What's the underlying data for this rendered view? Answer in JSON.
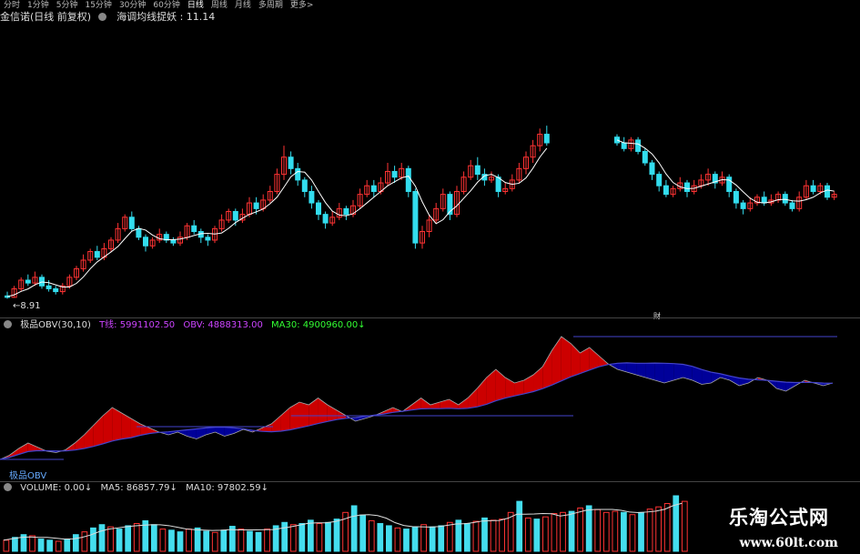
{
  "toolbar": {
    "periods": [
      "分时",
      "1分钟",
      "5分钟",
      "15分钟",
      "30分钟",
      "60分钟",
      "日线",
      "周线",
      "月线",
      "多周期",
      "更多>"
    ],
    "active_index": 6
  },
  "header": {
    "stock_name": "金信诺(日线 前复权)",
    "indicator_name": "海调均线捉妖",
    "indicator_value": ": 11.14"
  },
  "price_panel": {
    "low_label": "8.91",
    "marker_label": "财",
    "colors": {
      "up": "#ff3333",
      "down": "#33ddee",
      "ma": "#ffffff"
    }
  },
  "obv_panel": {
    "name": "极品OBV(30,10)",
    "t_label": "T线: 5991102.50",
    "obv_label": "OBV: 4888313.00",
    "ma30_label": "MA30: 4900960.00↓",
    "colors": {
      "t": "#cc44ff",
      "obv": "#cc44ff",
      "ma30": "#33ff33",
      "area_up": "#cc0000",
      "area_down": "#000099",
      "ref_line": "#4444cc"
    },
    "bottom_label": "极品OBV"
  },
  "volume_panel": {
    "name": "VOLUME: 0.00↓",
    "ma5": "MA5: 86857.79↓",
    "ma10": "MA10: 97802.59↓"
  },
  "watermark": {
    "title": "乐淘公式网",
    "url": "www.60lt.com"
  },
  "chart_data": {
    "type": "candlestick",
    "candles": [
      [
        8.95,
        8.9,
        9.1,
        8.85
      ],
      [
        8.9,
        9.2,
        9.3,
        8.88
      ],
      [
        9.2,
        9.5,
        9.6,
        9.1
      ],
      [
        9.5,
        9.4,
        9.7,
        9.3
      ],
      [
        9.4,
        9.6,
        9.8,
        9.3
      ],
      [
        9.6,
        9.3,
        9.7,
        9.2
      ],
      [
        9.3,
        9.2,
        9.5,
        9.1
      ],
      [
        9.2,
        9.1,
        9.3,
        9.0
      ],
      [
        9.1,
        9.3,
        9.4,
        9.0
      ],
      [
        9.3,
        9.6,
        9.7,
        9.2
      ],
      [
        9.6,
        9.9,
        10.0,
        9.5
      ],
      [
        9.9,
        10.2,
        10.4,
        9.8
      ],
      [
        10.2,
        10.5,
        10.6,
        10.1
      ],
      [
        10.5,
        10.3,
        10.7,
        10.2
      ],
      [
        10.3,
        10.6,
        10.8,
        10.2
      ],
      [
        10.6,
        10.9,
        11.0,
        10.5
      ],
      [
        10.9,
        11.3,
        11.5,
        10.8
      ],
      [
        11.3,
        11.7,
        11.8,
        11.2
      ],
      [
        11.7,
        11.3,
        11.9,
        11.2
      ],
      [
        11.3,
        11.0,
        11.4,
        10.9
      ],
      [
        11.0,
        10.7,
        11.1,
        10.5
      ],
      [
        10.7,
        10.9,
        11.0,
        10.6
      ],
      [
        10.9,
        11.1,
        11.3,
        10.8
      ],
      [
        11.1,
        10.9,
        11.2,
        10.8
      ],
      [
        10.9,
        10.8,
        11.0,
        10.7
      ],
      [
        10.8,
        11.0,
        11.2,
        10.7
      ],
      [
        11.0,
        11.4,
        11.5,
        10.9
      ],
      [
        11.4,
        11.2,
        11.6,
        11.1
      ],
      [
        11.2,
        11.0,
        11.3,
        10.8
      ],
      [
        11.0,
        10.9,
        11.1,
        10.7
      ],
      [
        10.9,
        11.3,
        11.4,
        10.8
      ],
      [
        11.3,
        11.6,
        11.8,
        11.2
      ],
      [
        11.6,
        11.9,
        12.0,
        11.5
      ],
      [
        11.9,
        11.6,
        12.0,
        11.4
      ],
      [
        11.6,
        11.8,
        12.0,
        11.5
      ],
      [
        11.8,
        12.2,
        12.4,
        11.7
      ],
      [
        12.2,
        12.0,
        12.4,
        11.8
      ],
      [
        12.0,
        12.3,
        12.5,
        11.9
      ],
      [
        12.3,
        12.6,
        12.8,
        12.2
      ],
      [
        12.6,
        13.2,
        13.4,
        12.5
      ],
      [
        13.2,
        13.8,
        14.2,
        13.0
      ],
      [
        13.8,
        13.4,
        14.0,
        13.2
      ],
      [
        13.4,
        13.0,
        13.6,
        12.8
      ],
      [
        13.0,
        12.6,
        13.1,
        12.4
      ],
      [
        12.6,
        12.2,
        12.8,
        12.0
      ],
      [
        12.2,
        11.8,
        12.3,
        11.6
      ],
      [
        11.8,
        11.5,
        11.9,
        11.3
      ],
      [
        11.5,
        11.7,
        11.9,
        11.4
      ],
      [
        11.7,
        12.0,
        12.2,
        11.6
      ],
      [
        12.0,
        11.8,
        12.1,
        11.6
      ],
      [
        11.8,
        12.1,
        12.3,
        11.7
      ],
      [
        12.1,
        12.5,
        12.7,
        12.0
      ],
      [
        12.5,
        12.8,
        13.0,
        12.4
      ],
      [
        12.8,
        12.6,
        13.0,
        12.4
      ],
      [
        12.6,
        12.9,
        13.1,
        12.5
      ],
      [
        12.9,
        13.3,
        13.6,
        12.8
      ],
      [
        13.3,
        13.1,
        13.5,
        12.9
      ],
      [
        13.1,
        13.4,
        13.6,
        13.0
      ],
      [
        13.4,
        12.6,
        13.5,
        12.4
      ],
      [
        12.6,
        10.8,
        12.7,
        10.6
      ],
      [
        10.8,
        11.2,
        11.4,
        10.6
      ],
      [
        11.2,
        11.6,
        11.8,
        11.0
      ],
      [
        11.6,
        12.0,
        12.2,
        11.5
      ],
      [
        12.0,
        12.5,
        12.7,
        11.9
      ],
      [
        12.5,
        11.8,
        12.6,
        11.6
      ],
      [
        11.8,
        12.6,
        12.8,
        11.7
      ],
      [
        12.6,
        13.1,
        13.3,
        12.5
      ],
      [
        13.1,
        13.5,
        13.7,
        13.0
      ],
      [
        13.5,
        13.2,
        13.8,
        13.0
      ],
      [
        13.2,
        13.0,
        13.4,
        12.8
      ],
      [
        13.0,
        13.1,
        13.3,
        12.9
      ],
      [
        13.1,
        12.6,
        13.2,
        12.4
      ],
      [
        12.6,
        12.7,
        12.9,
        12.5
      ],
      [
        12.7,
        13.0,
        13.2,
        12.6
      ],
      [
        13.0,
        13.4,
        13.6,
        12.9
      ],
      [
        13.4,
        13.8,
        14.0,
        13.2
      ],
      [
        13.8,
        14.2,
        14.4,
        13.6
      ],
      [
        14.2,
        14.6,
        14.8,
        14.0
      ],
      [
        14.6,
        14.3,
        14.9,
        14.2
      ]
    ],
    "candles2": [
      [
        14.5,
        14.3,
        14.6,
        14.2
      ],
      [
        14.3,
        14.1,
        14.5,
        14.0
      ],
      [
        14.1,
        14.4,
        14.5,
        14.0
      ],
      [
        14.4,
        14.0,
        14.5,
        13.9
      ],
      [
        14.0,
        13.6,
        14.1,
        13.5
      ],
      [
        13.6,
        13.2,
        13.7,
        13.0
      ],
      [
        13.2,
        12.8,
        13.3,
        12.6
      ],
      [
        12.8,
        12.5,
        13.0,
        12.4
      ],
      [
        12.5,
        12.7,
        12.8,
        12.4
      ],
      [
        12.7,
        12.9,
        13.1,
        12.6
      ],
      [
        12.9,
        12.6,
        13.0,
        12.4
      ],
      [
        12.6,
        12.8,
        13.0,
        12.5
      ],
      [
        12.8,
        13.0,
        13.2,
        12.7
      ],
      [
        13.0,
        13.2,
        13.4,
        12.8
      ],
      [
        13.2,
        12.9,
        13.3,
        12.7
      ],
      [
        12.9,
        13.1,
        13.3,
        12.8
      ],
      [
        13.1,
        12.6,
        13.2,
        12.4
      ],
      [
        12.6,
        12.2,
        12.7,
        12.0
      ],
      [
        12.2,
        12.0,
        12.3,
        11.8
      ],
      [
        12.0,
        12.2,
        12.4,
        11.9
      ],
      [
        12.2,
        12.4,
        12.5,
        12.1
      ],
      [
        12.4,
        12.2,
        12.6,
        12.1
      ],
      [
        12.2,
        12.3,
        12.5,
        12.1
      ],
      [
        12.3,
        12.5,
        12.6,
        12.2
      ],
      [
        12.5,
        12.2,
        12.6,
        12.1
      ],
      [
        12.2,
        12.0,
        12.3,
        11.9
      ],
      [
        12.0,
        12.4,
        12.6,
        11.9
      ],
      [
        12.4,
        12.8,
        13.0,
        12.3
      ],
      [
        12.8,
        12.6,
        13.0,
        12.5
      ],
      [
        12.6,
        12.8,
        12.9,
        12.5
      ],
      [
        12.8,
        12.4,
        12.9,
        12.3
      ],
      [
        12.4,
        12.5,
        12.6,
        12.3
      ]
    ],
    "obv": [
      0.1,
      0.13,
      0.18,
      0.22,
      0.19,
      0.16,
      0.15,
      0.17,
      0.22,
      0.28,
      0.35,
      0.42,
      0.48,
      0.44,
      0.4,
      0.36,
      0.33,
      0.3,
      0.28,
      0.3,
      0.27,
      0.25,
      0.28,
      0.3,
      0.27,
      0.29,
      0.32,
      0.3,
      0.33,
      0.36,
      0.42,
      0.48,
      0.52,
      0.5,
      0.55,
      0.5,
      0.46,
      0.42,
      0.38,
      0.4,
      0.42,
      0.45,
      0.48,
      0.45,
      0.5,
      0.55,
      0.5,
      0.52,
      0.54,
      0.5,
      0.55,
      0.62,
      0.7,
      0.76,
      0.7,
      0.66,
      0.68,
      0.72,
      0.78,
      0.9,
      1.0,
      0.95,
      0.88,
      0.92,
      0.86,
      0.8,
      0.76,
      0.74,
      0.72,
      0.7,
      0.68,
      0.66,
      0.68,
      0.7,
      0.68,
      0.65,
      0.66,
      0.7,
      0.68,
      0.64,
      0.66,
      0.7,
      0.68,
      0.62,
      0.6,
      0.64,
      0.68,
      0.66,
      0.64,
      0.66
    ],
    "volume": [
      0.2,
      0.25,
      0.3,
      0.28,
      0.22,
      0.2,
      0.18,
      0.22,
      0.3,
      0.35,
      0.42,
      0.48,
      0.44,
      0.4,
      0.46,
      0.5,
      0.55,
      0.48,
      0.4,
      0.38,
      0.35,
      0.4,
      0.42,
      0.36,
      0.34,
      0.38,
      0.45,
      0.4,
      0.36,
      0.34,
      0.4,
      0.46,
      0.52,
      0.48,
      0.5,
      0.56,
      0.5,
      0.52,
      0.58,
      0.7,
      0.82,
      0.65,
      0.55,
      0.5,
      0.46,
      0.42,
      0.4,
      0.44,
      0.48,
      0.44,
      0.46,
      0.52,
      0.56,
      0.5,
      0.54,
      0.6,
      0.56,
      0.58,
      0.7,
      0.9,
      0.6,
      0.58,
      0.62,
      0.68,
      0.7,
      0.72,
      0.78,
      0.82,
      0.75,
      0.7,
      0.72,
      0.7,
      0.66,
      0.7,
      0.76,
      0.8,
      0.86,
      1.0,
      0.9
    ]
  }
}
